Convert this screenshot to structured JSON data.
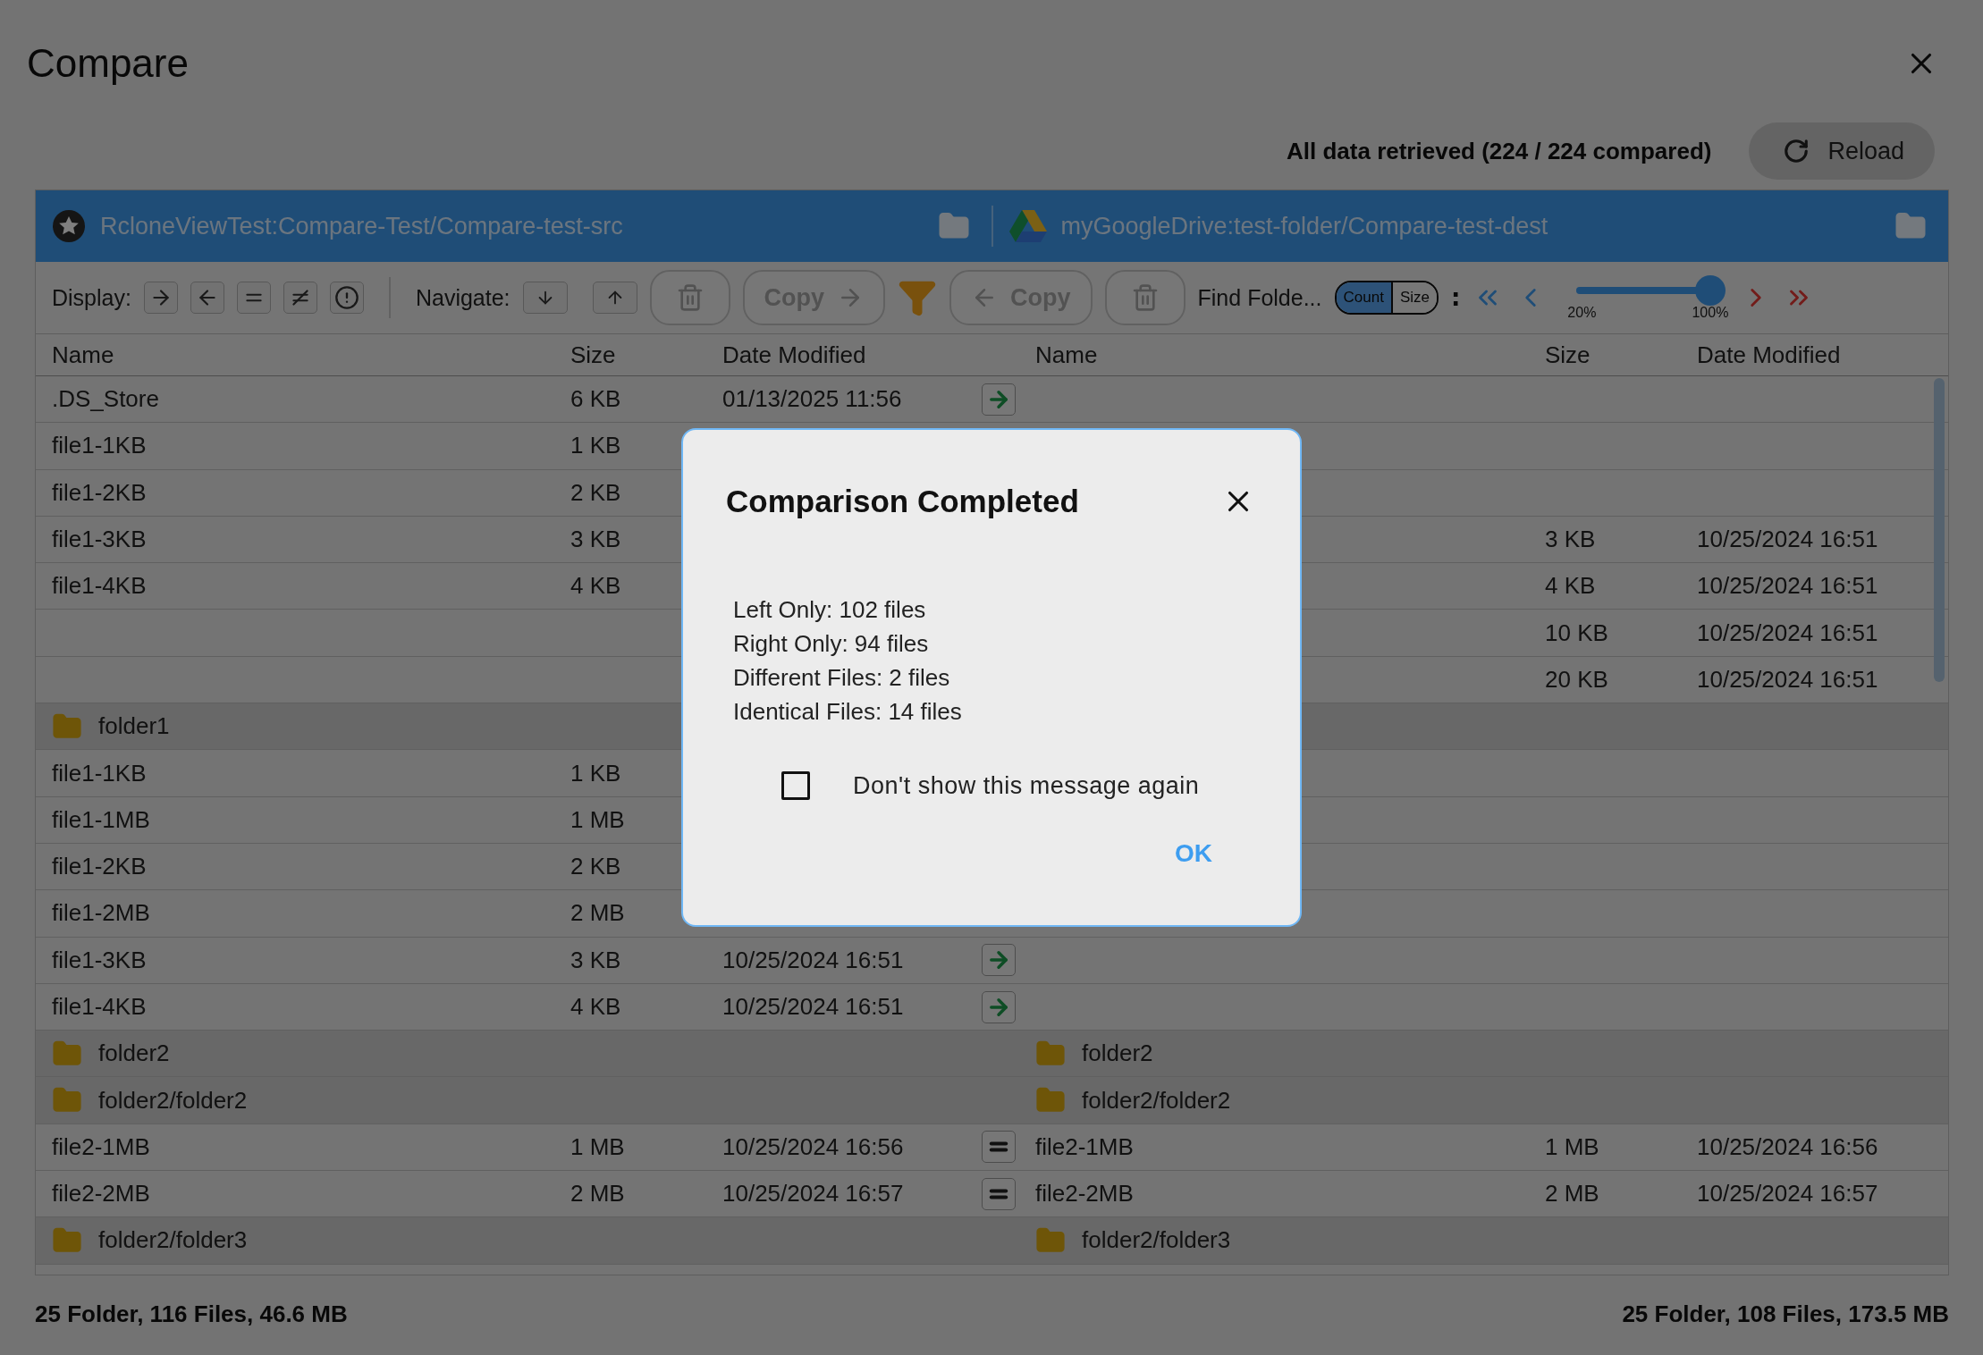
{
  "window": {
    "title": "Compare"
  },
  "status": {
    "message": "All data retrieved (224 / 224 compared)",
    "reload": "Reload"
  },
  "paths": [
    {
      "label": "RcloneViewTest:Compare-Test/Compare-test-src",
      "kind": "star"
    },
    {
      "label": "myGoogleDrive:test-folder/Compare-test-dest",
      "kind": "gdrive"
    }
  ],
  "toolbar": {
    "display_label": "Display:",
    "navigate_label": "Navigate:",
    "copy_right": "Copy",
    "copy_left": "Copy",
    "find_folder": "Find Folde...",
    "toggle": [
      {
        "label": "Count",
        "selected": true
      },
      {
        "label": "Size",
        "selected": false
      }
    ],
    "colon": ":",
    "slider": {
      "level": 1,
      "min_label": "20%",
      "max_label": "100%"
    }
  },
  "columns": {
    "left": [
      "Name",
      "Size",
      "Date Modified"
    ],
    "right": [
      "Name",
      "Size",
      "Date Modified"
    ]
  },
  "rows": [
    {
      "kind": "file",
      "left": {
        "name": ".DS_Store",
        "size": "6 KB",
        "date": "01/13/2025 11:56"
      },
      "status": {
        "kind": "left_only"
      }
    },
    {
      "kind": "file",
      "left": {
        "name": "file1-1KB",
        "size": "1 KB"
      }
    },
    {
      "kind": "file",
      "left": {
        "name": "file1-2KB",
        "size": "2 KB"
      }
    },
    {
      "kind": "file",
      "left": {
        "name": "file1-3KB",
        "size": "3 KB"
      },
      "right": {
        "size": "3 KB",
        "date": "10/25/2024 16:51"
      }
    },
    {
      "kind": "file",
      "left": {
        "name": "file1-4KB",
        "size": "4 KB"
      },
      "right": {
        "size": "4 KB",
        "date": "10/25/2024 16:51"
      }
    },
    {
      "kind": "file",
      "right": {
        "size": "10 KB",
        "date": "10/25/2024 16:51"
      }
    },
    {
      "kind": "file",
      "right": {
        "size": "20 KB",
        "date": "10/25/2024 16:51"
      }
    },
    {
      "kind": "folder",
      "left": {
        "name": "folder1"
      }
    },
    {
      "kind": "file",
      "left": {
        "name": "file1-1KB",
        "size": "1 KB"
      }
    },
    {
      "kind": "file",
      "left": {
        "name": "file1-1MB",
        "size": "1 MB"
      }
    },
    {
      "kind": "file",
      "left": {
        "name": "file1-2KB",
        "size": "2 KB"
      }
    },
    {
      "kind": "file",
      "left": {
        "name": "file1-2MB",
        "size": "2 MB"
      }
    },
    {
      "kind": "file",
      "left": {
        "name": "file1-3KB",
        "size": "3 KB",
        "date": "10/25/2024 16:51"
      },
      "status": {
        "kind": "left_only"
      }
    },
    {
      "kind": "file",
      "left": {
        "name": "file1-4KB",
        "size": "4 KB",
        "date": "10/25/2024 16:51"
      },
      "status": {
        "kind": "left_only"
      }
    },
    {
      "kind": "folder",
      "left": {
        "name": "folder2"
      },
      "right": {
        "name": "folder2"
      }
    },
    {
      "kind": "folder",
      "left": {
        "name": "folder2/folder2"
      },
      "right": {
        "name": "folder2/folder2"
      }
    },
    {
      "kind": "file",
      "left": {
        "name": "file2-1MB",
        "size": "1 MB",
        "date": "10/25/2024 16:56"
      },
      "status": {
        "kind": "identical"
      },
      "right": {
        "name": "file2-1MB",
        "size": "1 MB",
        "date": "10/25/2024 16:56"
      }
    },
    {
      "kind": "file",
      "left": {
        "name": "file2-2MB",
        "size": "2 MB",
        "date": "10/25/2024 16:57"
      },
      "status": {
        "kind": "identical"
      },
      "right": {
        "name": "file2-2MB",
        "size": "2 MB",
        "date": "10/25/2024 16:57"
      }
    },
    {
      "kind": "folder",
      "left": {
        "name": "folder2/folder3"
      },
      "right": {
        "name": "folder2/folder3"
      }
    }
  ],
  "footer": {
    "left": "25 Folder, 116 Files, 46.6 MB",
    "right": "25 Folder, 108 Files, 173.5 MB"
  },
  "dialog": {
    "title": "Comparison Completed",
    "lines": [
      "Left Only: 102 files",
      "Right Only: 94 files",
      "Different Files: 2 files",
      "Identical Files: 14 files"
    ],
    "checkbox": {
      "label": "Don't show this message again",
      "checked": false
    },
    "ok": "OK"
  }
}
